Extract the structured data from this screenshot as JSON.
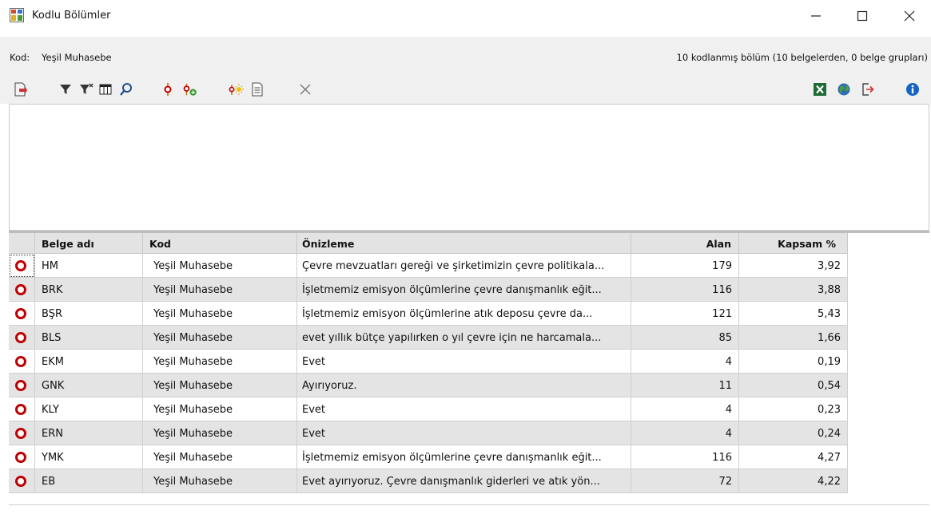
{
  "window": {
    "title": "Kodlu Bölümler",
    "controls": {
      "minimize": "—",
      "maximize": "☐",
      "close": "✕"
    }
  },
  "info": {
    "code_label": "Kod:",
    "code_value": "Yeşil Muhasebe",
    "summary": "10 kodlanmış bölüm (10 belgelerden, 0 belge grupları)"
  },
  "toolbar": {
    "left_icons": [
      "export-icon",
      "filter-icon",
      "clear-filter-icon",
      "columns-icon",
      "search-icon",
      "code-icon",
      "add-code-icon",
      "highlight-icon",
      "document-icon",
      "close-icon"
    ],
    "right_icons": [
      "excel-icon",
      "web-icon",
      "exit-icon",
      "info-icon"
    ]
  },
  "table": {
    "columns": [
      "Belge adı",
      "Kod",
      "Önizleme",
      "Alan",
      "Kapsam %"
    ],
    "rows": [
      {
        "doc": "HM",
        "code": "Yeşil Muhasebe",
        "preview": "Çevre mevzuatları gereği ve şirketimizin çevre politikala...",
        "area": "179",
        "coverage": "3,92"
      },
      {
        "doc": "BRK",
        "code": "Yeşil Muhasebe",
        "preview": "İşletmemiz emisyon ölçümlerine çevre danışmanlık eğit...",
        "area": "116",
        "coverage": "3,88"
      },
      {
        "doc": "BŞR",
        "code": "Yeşil Muhasebe",
        "preview": "İşletmemiz emisyon ölçümlerine atık deposu çevre da...",
        "area": "121",
        "coverage": "5,43"
      },
      {
        "doc": "BLS",
        "code": "Yeşil Muhasebe",
        "preview": "evet yıllık bütçe yapılırken o yıl çevre için ne harcamala...",
        "area": "85",
        "coverage": "1,66"
      },
      {
        "doc": "EKM",
        "code": "Yeşil Muhasebe",
        "preview": "Evet",
        "area": "4",
        "coverage": "0,19"
      },
      {
        "doc": "GNK",
        "code": "Yeşil Muhasebe",
        "preview": "Ayırıyoruz.",
        "area": "11",
        "coverage": "0,54"
      },
      {
        "doc": "KLY",
        "code": "Yeşil Muhasebe",
        "preview": "Evet",
        "area": "4",
        "coverage": "0,23"
      },
      {
        "doc": "ERN",
        "code": "Yeşil Muhasebe",
        "preview": "Evet",
        "area": "4",
        "coverage": "0,24"
      },
      {
        "doc": "YMK",
        "code": "Yeşil Muhasebe",
        "preview": "İşletmemiz emisyon ölçümlerine çevre danışmanlık eğit...",
        "area": "116",
        "coverage": "4,27"
      },
      {
        "doc": "EB",
        "code": "Yeşil Muhasebe",
        "preview": "Evet ayırıyoruz. Çevre danışmanlık giderleri ve atık yön...",
        "area": "72",
        "coverage": "4,22"
      }
    ]
  },
  "colors": {
    "marker": "#c00000",
    "alt_row": "#e4e4e4",
    "header": "#e3e3e3",
    "bar": "#f0f0f0"
  }
}
